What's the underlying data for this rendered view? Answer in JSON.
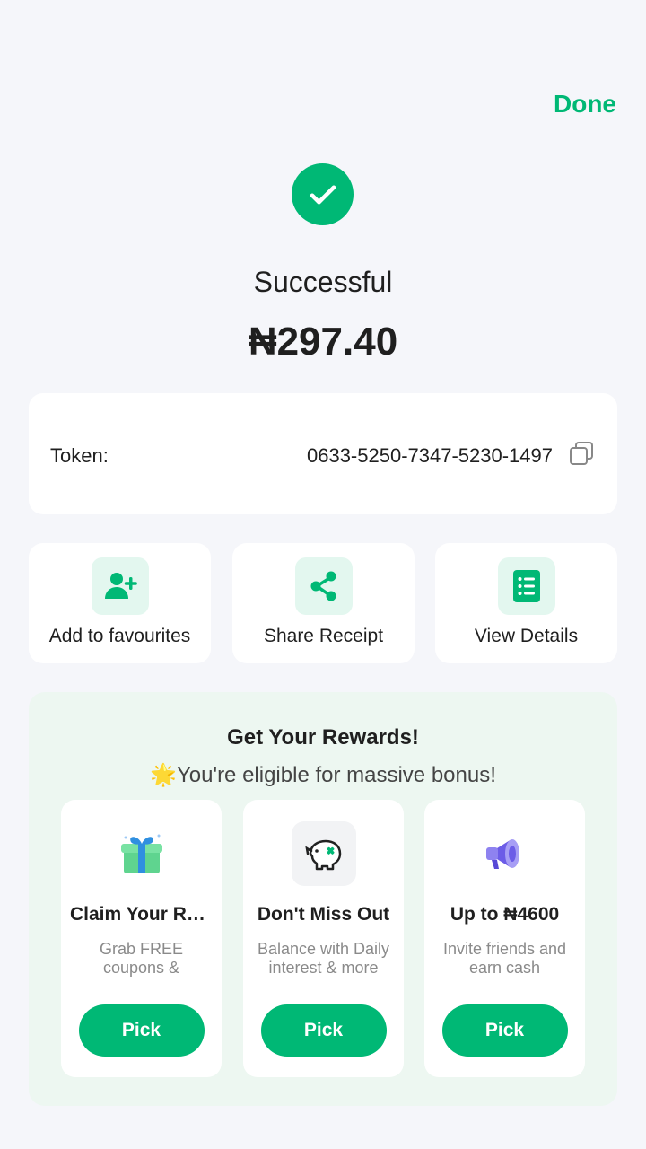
{
  "header": {
    "done_label": "Done"
  },
  "result": {
    "status": "Successful",
    "amount": "₦297.40"
  },
  "token": {
    "label": "Token:",
    "value": "0633-5250-7347-5230-1497"
  },
  "actions": [
    {
      "label": "Add to favourites",
      "icon": "add-user-icon"
    },
    {
      "label": "Share Receipt",
      "icon": "share-icon"
    },
    {
      "label": "View Details",
      "icon": "list-details-icon"
    }
  ],
  "rewards": {
    "title": "Get Your Rewards!",
    "subtitle_star": "🌟",
    "subtitle": "You're eligible for massive bonus!",
    "cards": [
      {
        "title": "Claim Your Rewards",
        "description": "Grab FREE coupons & cashback",
        "button": "Pick",
        "icon": "gift-icon"
      },
      {
        "title": "Don't Miss Out",
        "description": "Balance with Daily interest & more",
        "button": "Pick",
        "icon": "piggy-bank-icon"
      },
      {
        "title": "Up to ₦4600",
        "description": "Invite friends and earn cash",
        "button": "Pick",
        "icon": "megaphone-icon"
      }
    ]
  },
  "colors": {
    "accent": "#00b875",
    "accent_light": "#e3f7ef",
    "rewards_bg": "#edf7f1"
  }
}
